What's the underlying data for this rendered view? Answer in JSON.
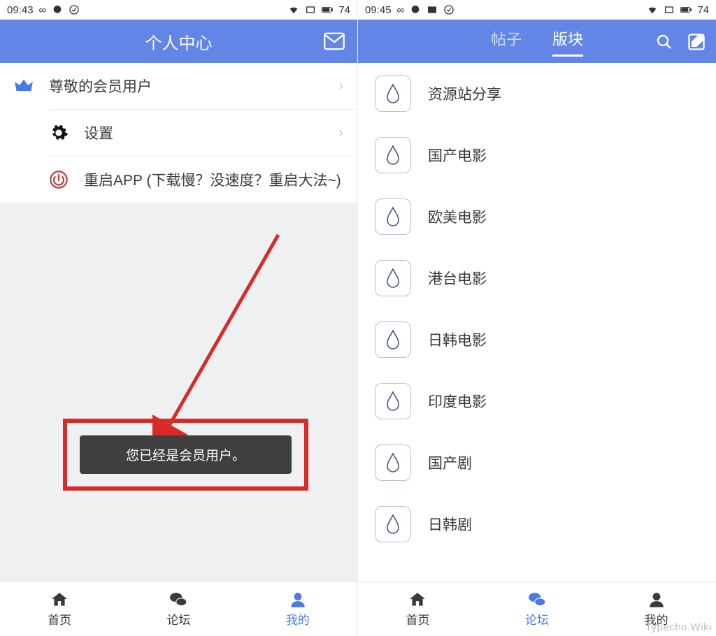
{
  "left": {
    "status": {
      "time": "09:43",
      "battery": "74"
    },
    "header": {
      "title": "个人中心"
    },
    "rows": [
      {
        "label": "尊敬的会员用户",
        "icon": "crown",
        "chevron": true
      },
      {
        "label": "设置",
        "icon": "gear",
        "chevron": true
      },
      {
        "label": "重启APP (下载慢？没速度？重启大法~)",
        "icon": "power",
        "chevron": false
      }
    ],
    "toast": "您已经是会员用户。",
    "nav": [
      {
        "label": "首页",
        "icon": "home"
      },
      {
        "label": "论坛",
        "icon": "forum"
      },
      {
        "label": "我的",
        "icon": "user",
        "active": true
      }
    ]
  },
  "right": {
    "status": {
      "time": "09:45",
      "battery": "74"
    },
    "header": {
      "tabs": [
        {
          "label": "帖子"
        },
        {
          "label": "版块",
          "active": true
        }
      ]
    },
    "forums": [
      {
        "label": "资源站分享"
      },
      {
        "label": "国产电影"
      },
      {
        "label": "欧美电影"
      },
      {
        "label": "港台电影"
      },
      {
        "label": "日韩电影"
      },
      {
        "label": "印度电影"
      },
      {
        "label": "国产剧"
      },
      {
        "label": "日韩剧"
      }
    ],
    "nav": [
      {
        "label": "首页",
        "icon": "home"
      },
      {
        "label": "论坛",
        "icon": "forum",
        "active": true
      },
      {
        "label": "我的",
        "icon": "user"
      }
    ]
  },
  "watermark": "Typecho.Wiki"
}
